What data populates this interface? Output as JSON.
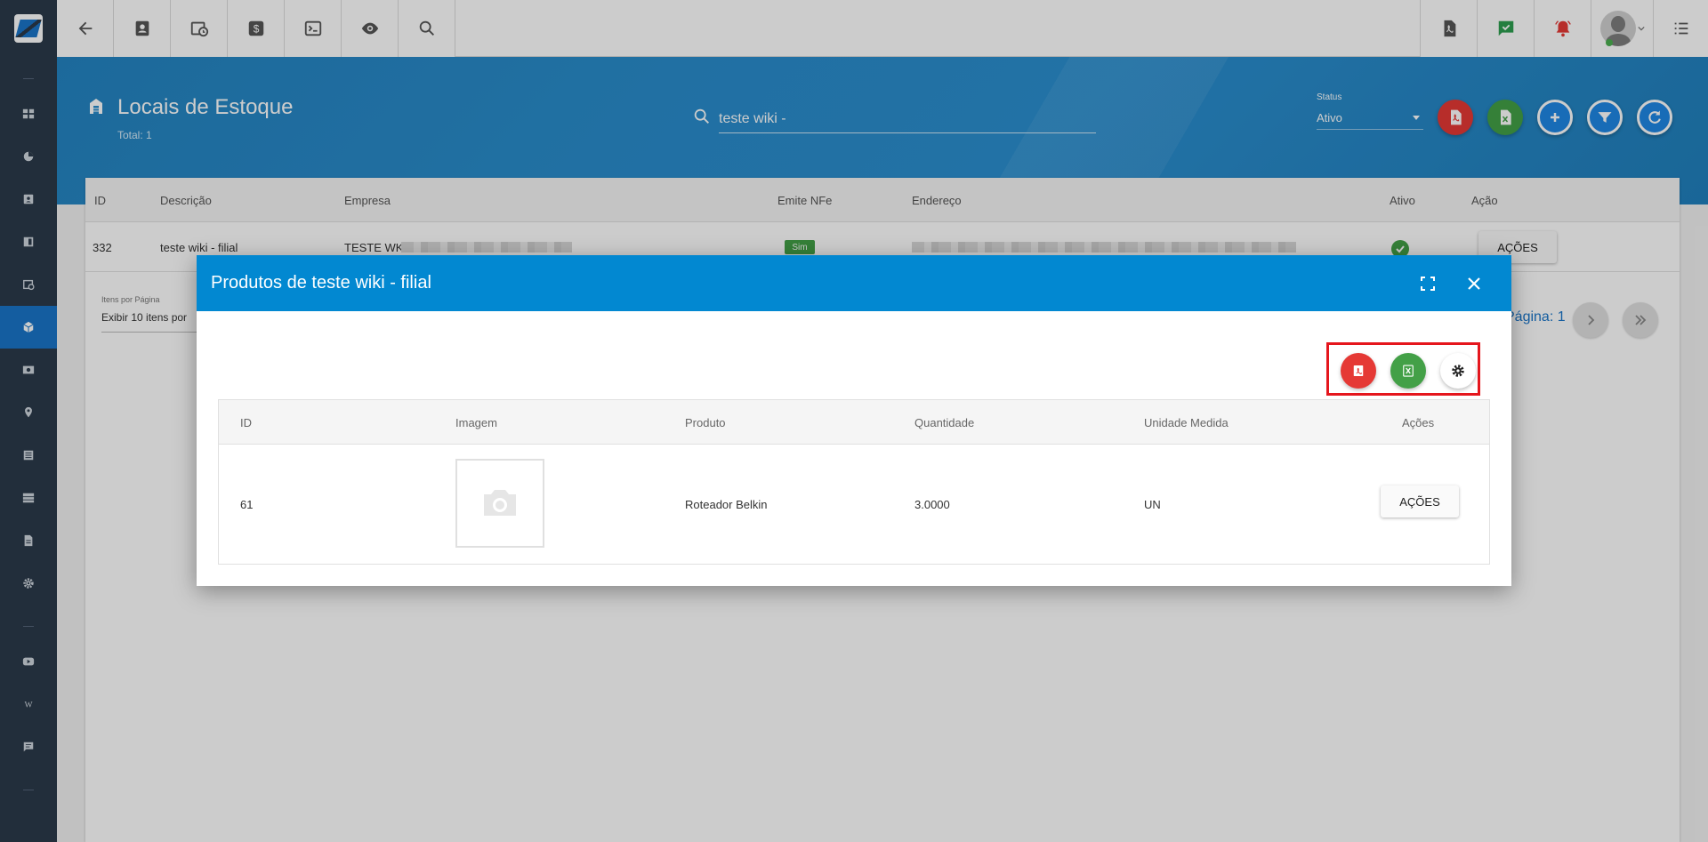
{
  "topbar": {
    "left_icons": [
      "back-arrow-icon",
      "contact-card-icon",
      "calendar-clock-icon",
      "dollar-icon",
      "terminal-icon",
      "eye-icon",
      "search-icon"
    ],
    "right_icons": [
      "pdf-icon",
      "chat-check-icon",
      "bell-alert-icon",
      "user-avatar",
      "list-menu-icon"
    ]
  },
  "sidebar": {
    "items": [
      "dashboard-icon",
      "pie-chart-icon",
      "id-card-icon",
      "book-icon",
      "calendar-icon",
      "box-icon",
      "money-icon",
      "location-pin-icon",
      "document-list-icon",
      "server-icon",
      "file-icon",
      "gear-icon",
      "youtube-icon",
      "wiki-icon",
      "comment-icon"
    ],
    "active": "box-icon"
  },
  "header": {
    "title": "Locais de Estoque",
    "total": "Total: 1",
    "search_value": "teste wiki -",
    "status_label": "Status",
    "status_value": "Ativo",
    "action_colors": {
      "pdf": "#e53935",
      "excel": "#43a047",
      "add": "#1e88e5",
      "filter": "#1e88e5",
      "refresh": "#1e88e5"
    }
  },
  "main_table": {
    "columns": [
      "ID",
      "Descrição",
      "Empresa",
      "Emite NFe",
      "Endereço",
      "Ativo",
      "Ação"
    ],
    "rows": [
      {
        "id": "332",
        "descricao": "teste wiki - filial",
        "empresa": "TESTE WK",
        "emite_nfe": "Sim",
        "acao": "AÇÕES"
      }
    ],
    "per_page_label": "Itens por Página",
    "per_page_value": "Exibir 10 itens por",
    "page_label": "Página: 1"
  },
  "modal": {
    "title": "Produtos de teste wiki - filial",
    "colors": {
      "header": "#0288d1",
      "highlight": "#e5161d",
      "pdf": "#e53935",
      "excel": "#43a047"
    },
    "columns": [
      "ID",
      "Imagem",
      "Produto",
      "Quantidade",
      "Unidade Medida",
      "Ações"
    ],
    "rows": [
      {
        "id": "61",
        "produto": "Roteador Belkin",
        "quantidade": "3.0000",
        "unidade": "UN",
        "acao": "AÇÕES"
      }
    ]
  }
}
